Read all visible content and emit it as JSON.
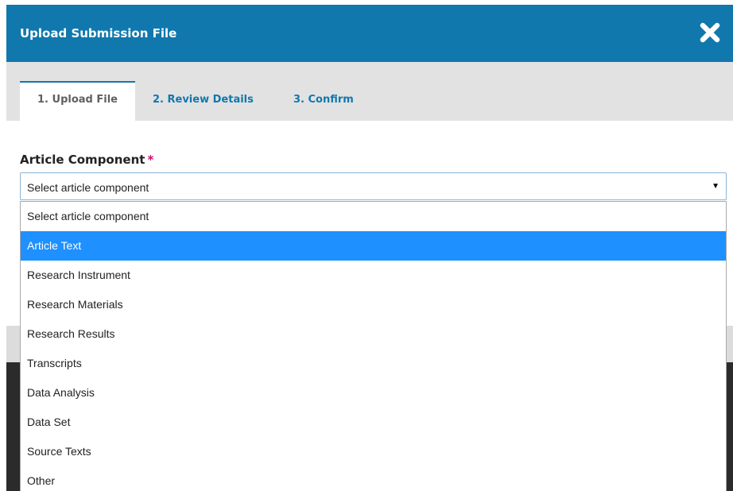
{
  "modal": {
    "title": "Upload Submission File",
    "close_icon": "close-x-icon"
  },
  "tabs": [
    {
      "label": "1. Upload File",
      "active": true
    },
    {
      "label": "2. Review Details",
      "active": false
    },
    {
      "label": "3. Confirm",
      "active": false
    }
  ],
  "form": {
    "article_component": {
      "label": "Article Component",
      "required_marker": "*",
      "selected_value": "Select article component",
      "highlighted_option": "Article Text",
      "options": [
        "Select article component",
        "Article Text",
        "Research Instrument",
        "Research Materials",
        "Research Results",
        "Transcripts",
        "Data Analysis",
        "Data Set",
        "Source Texts",
        "Other"
      ]
    }
  },
  "colors": {
    "header_background": "#1178ad",
    "tab_bar_background": "#e2e2e2",
    "tab_link": "#1178ad",
    "required_marker": "#d00a6c",
    "option_highlight": "#1e90ff"
  }
}
